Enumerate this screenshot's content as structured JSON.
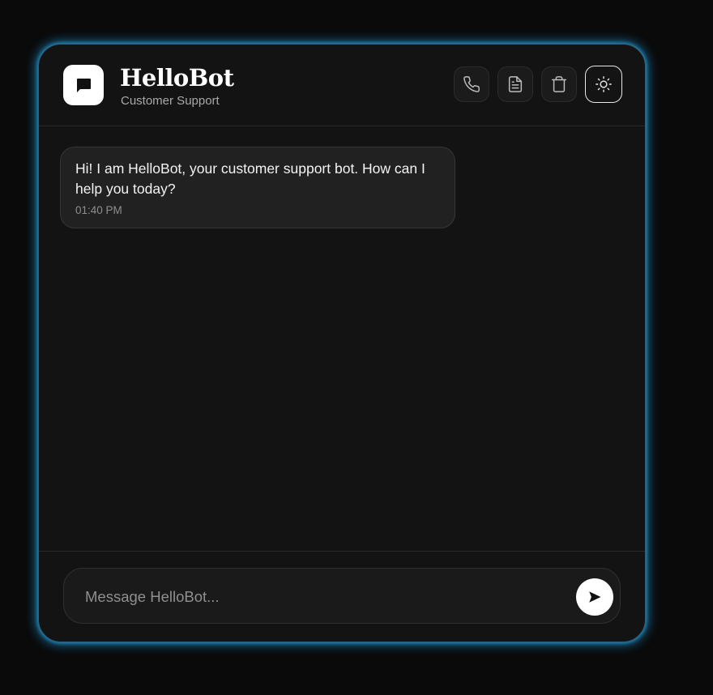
{
  "header": {
    "title": "HelloBot",
    "subtitle": "Customer Support",
    "logo_icon": "chat-bubble-icon",
    "actions": [
      {
        "name": "call-button",
        "icon": "phone-icon"
      },
      {
        "name": "transcript-button",
        "icon": "document-icon"
      },
      {
        "name": "clear-chat-button",
        "icon": "trash-icon"
      },
      {
        "name": "theme-toggle-button",
        "icon": "sun-icon",
        "active": true
      }
    ]
  },
  "messages": [
    {
      "sender": "bot",
      "text": "Hi! I am HelloBot, your customer support bot. How can I help you today?",
      "time": "01:40 PM"
    }
  ],
  "composer": {
    "placeholder": "Message HelloBot...",
    "value": "",
    "send_icon": "send-arrow-icon"
  },
  "colors": {
    "background": "#0a0a0a",
    "panel": "#131313",
    "glow": "#1ea0e6",
    "text": "#ffffff",
    "muted": "#a9a9a9"
  }
}
